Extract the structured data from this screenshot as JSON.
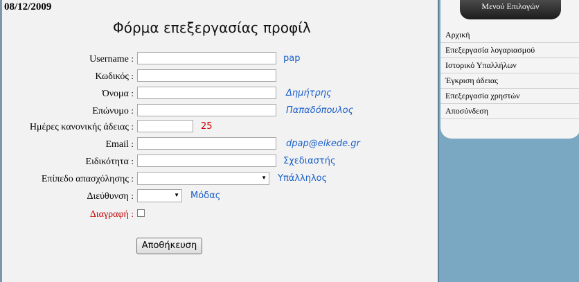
{
  "date": "08/12/2009",
  "form": {
    "title": "Φόρμα επεξεργασίας προφίλ",
    "colon": ":",
    "fields": {
      "username": {
        "label": "Username",
        "value": "pap"
      },
      "password": {
        "label": "Κωδικός",
        "value": ""
      },
      "first_name": {
        "label": "Όνομα",
        "value": "Δημήτρης"
      },
      "last_name": {
        "label": "Επώνυμο",
        "value": "Παπαδόπουλος"
      },
      "leave_days": {
        "label": "Ημέρες κανονικής άδειας",
        "value": "25"
      },
      "email": {
        "label": "Email",
        "value": "dpap@elkede.gr"
      },
      "specialty": {
        "label": "Ειδικότητα",
        "value": "Σχεδιαστής"
      },
      "employment_level": {
        "label": "Επίπεδο απασχόλησης",
        "value": "Υπάλληλος"
      },
      "department": {
        "label": "Διεύθυνση",
        "value": "Μόδας"
      },
      "delete": {
        "label": "Διαγραφή"
      }
    },
    "save_label": "Αποθήκευση"
  },
  "sidebar": {
    "header": "Μενού Επιλογών",
    "items": [
      {
        "label": "Αρχική"
      },
      {
        "label": "Επεξεργασία λογαριασμού"
      },
      {
        "label": "Ιστορικό Υπαλλήλων"
      },
      {
        "label": "Έγκριση άδειας"
      },
      {
        "label": "Επεξεργασία χρηστών"
      },
      {
        "label": "Αποσύνδεση"
      }
    ]
  }
}
